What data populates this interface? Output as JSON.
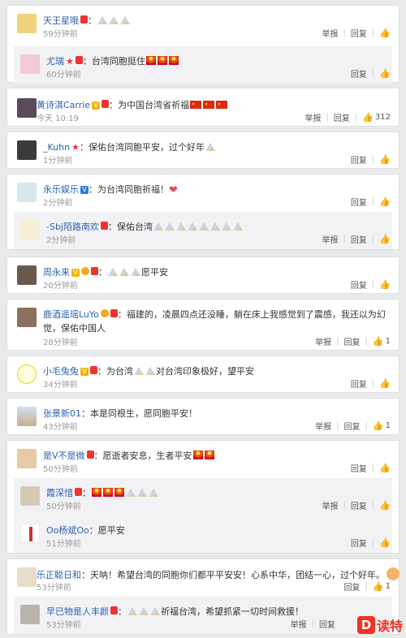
{
  "labels": {
    "report": "举报",
    "reply": "回复",
    "separator": "|"
  },
  "logo": {
    "mark": "D",
    "text": "读特"
  },
  "comments": [
    {
      "user": "天王星哦",
      "text": "：",
      "time": "59分钟前",
      "actions": [
        "report",
        "reply",
        "like"
      ],
      "likes": ""
    },
    {
      "user": "尤瑞",
      "text": "：台湾同胞挺住",
      "time": "60分钟前",
      "actions": [
        "reply",
        "like"
      ],
      "likes": ""
    },
    {
      "user": "黄诗淇Carrie",
      "text": "：为中国台湾省祈福",
      "time": "今天 10:19",
      "actions": [
        "report",
        "reply",
        "like"
      ],
      "likes": "312"
    },
    {
      "user": "_Kuhn",
      "text": "：保佑台湾同胞平安，过个好年",
      "time": "1分钟前",
      "actions": [
        "reply",
        "like"
      ],
      "likes": ""
    },
    {
      "user": "永乐娱乐",
      "text": "：为台湾同胞祈福！",
      "time": "2分钟前",
      "actions": [
        "reply",
        "like"
      ],
      "likes": ""
    },
    {
      "user": "-Sbj陌路南欢",
      "text": "：保佑台湾",
      "time": "2分钟前",
      "actions": [
        "report",
        "reply",
        "like"
      ],
      "likes": ""
    },
    {
      "user": "周永来",
      "text": "：",
      "text2": "愿平安",
      "time": "20分钟前",
      "actions": [
        "reply",
        "like"
      ],
      "likes": ""
    },
    {
      "user": "鹿酒遥瑶LuYo",
      "text": "：福建的，凌晨四点还没睡，躺在床上我感觉到了震感，我还以为幻觉，保佑",
      "text_cont": "中国人",
      "time": "28分钟前",
      "actions": [
        "report",
        "reply",
        "like"
      ],
      "likes": "1"
    },
    {
      "user": "小毛兔兔",
      "text": "：为台湾",
      "text2": "对台湾印象极好，望平安",
      "time": "34分钟前",
      "actions": [
        "reply",
        "like"
      ],
      "likes": ""
    },
    {
      "user": "张景新01",
      "text": "：本是同根生，愿同胞平安！",
      "time": "43分钟前",
      "actions": [
        "report",
        "reply",
        "like"
      ],
      "likes": "1"
    },
    {
      "user": "是V不是微",
      "text": "：愿逝者安息，生者平安",
      "time": "50分钟前",
      "actions": [
        "reply",
        "like"
      ],
      "likes": ""
    },
    {
      "user": "霞深惜",
      "text": "：",
      "time": "50分钟前",
      "actions": [
        "report",
        "reply",
        "like"
      ],
      "likes": ""
    },
    {
      "user": "Oo杨斌Oo",
      "text": "：愿平安",
      "time": "51分钟前",
      "actions": [
        "reply",
        "like"
      ],
      "likes": ""
    },
    {
      "user": "乐正聪日和",
      "text": "：天呐！希望台湾的同胞你们都平平安安！心系中华，团结一心，过个好年。",
      "time": "53分钟前",
      "actions": [
        "reply",
        "like"
      ],
      "likes": "1"
    },
    {
      "user": "早已物是人丰颜",
      "text": "：",
      "text2": "祈福台湾，希望抓紧一切时间救援！",
      "time": "53分钟前",
      "actions": [
        "report",
        "reply",
        "like"
      ],
      "likes": ""
    }
  ]
}
